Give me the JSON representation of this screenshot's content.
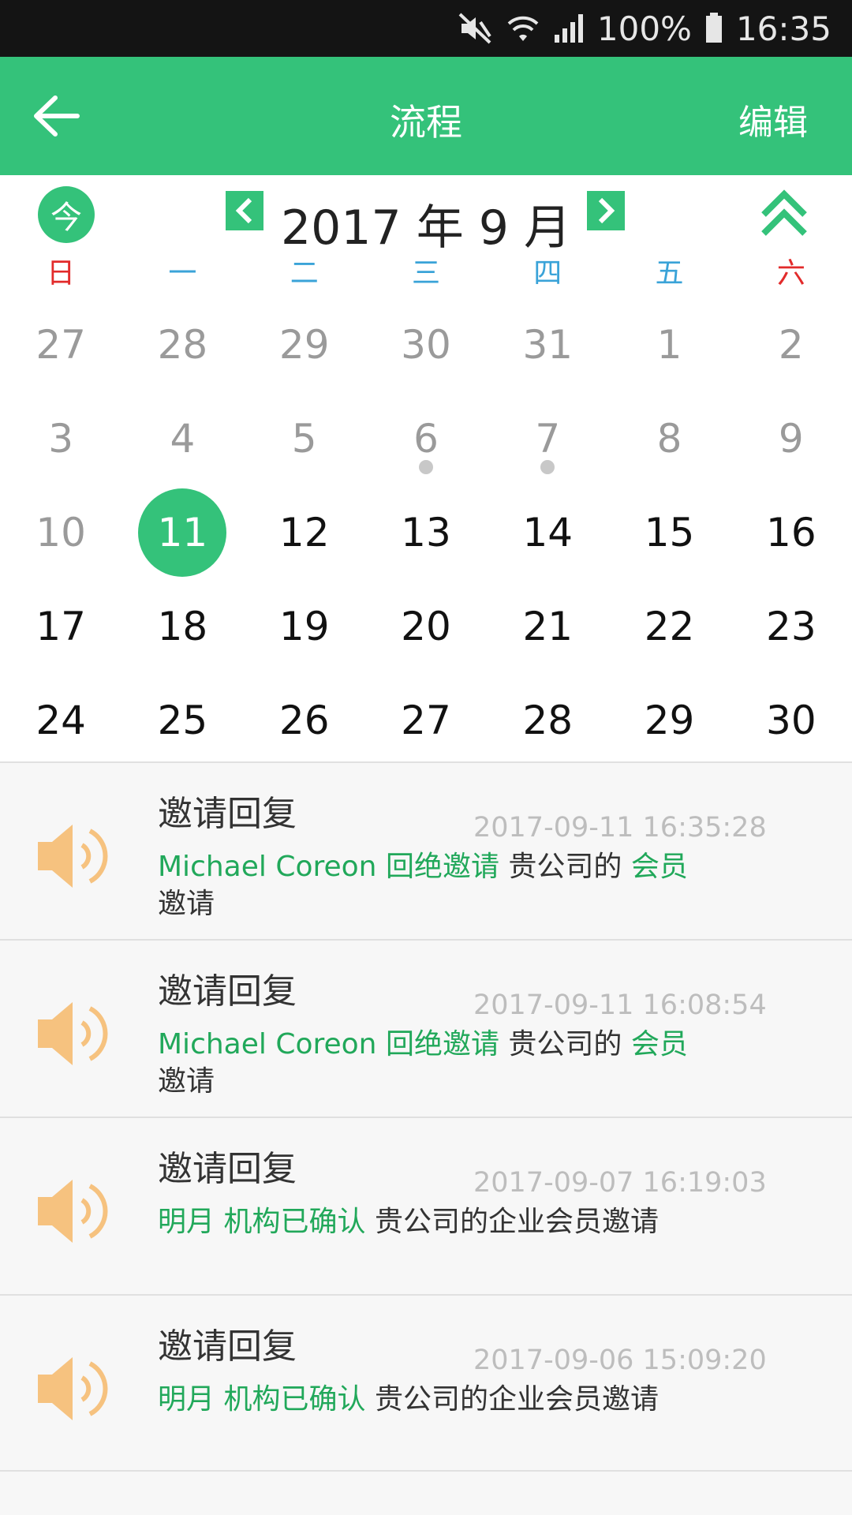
{
  "status_bar": {
    "battery": "100%",
    "time": "16:35"
  },
  "header": {
    "title": "流程",
    "edit_label": "编辑"
  },
  "calendar": {
    "today_label": "今",
    "month_label": "2017 年 9 月",
    "weekdays": [
      "日",
      "一",
      "二",
      "三",
      "四",
      "五",
      "六"
    ],
    "days": [
      {
        "label": "27"
      },
      {
        "label": "28"
      },
      {
        "label": "29"
      },
      {
        "label": "30"
      },
      {
        "label": "31"
      },
      {
        "label": "1"
      },
      {
        "label": "2"
      },
      {
        "label": "3"
      },
      {
        "label": "4"
      },
      {
        "label": "5"
      },
      {
        "label": "6"
      },
      {
        "label": "7"
      },
      {
        "label": "8"
      },
      {
        "label": "9"
      },
      {
        "label": "10"
      },
      {
        "label": "11"
      },
      {
        "label": "12"
      },
      {
        "label": "13"
      },
      {
        "label": "14"
      },
      {
        "label": "15"
      },
      {
        "label": "16"
      },
      {
        "label": "17"
      },
      {
        "label": "18"
      },
      {
        "label": "19"
      },
      {
        "label": "20"
      },
      {
        "label": "21"
      },
      {
        "label": "22"
      },
      {
        "label": "23"
      },
      {
        "label": "24"
      },
      {
        "label": "25"
      },
      {
        "label": "26"
      },
      {
        "label": "27"
      },
      {
        "label": "28"
      },
      {
        "label": "29"
      },
      {
        "label": "30"
      }
    ]
  },
  "notifications": [
    {
      "title": "邀请回复",
      "time": "2017-09-11 16:35:28",
      "name": "Michael Coreon",
      "action": "回绝邀请",
      "text1": "贵公司的",
      "tag": "会员",
      "text2": "邀请"
    },
    {
      "title": "邀请回复",
      "time": "2017-09-11 16:08:54",
      "name": "Michael Coreon",
      "action": "回绝邀请",
      "text1": "贵公司的",
      "tag": "会员",
      "text2": "邀请"
    },
    {
      "title": "邀请回复",
      "time": "2017-09-07 16:19:03",
      "name": "明月",
      "action": "机构已确认",
      "text1": "贵公司的企业会员邀请"
    },
    {
      "title": "邀请回复",
      "time": "2017-09-06 15:09:20",
      "name": "明月",
      "action": "机构已确认",
      "text1": "贵公司的企业会员邀请"
    }
  ],
  "colors": {
    "accent": "#34c27a",
    "weekday": "#3aa3d8",
    "weekend": "#e22b2b",
    "speaker": "#f6c27f"
  }
}
